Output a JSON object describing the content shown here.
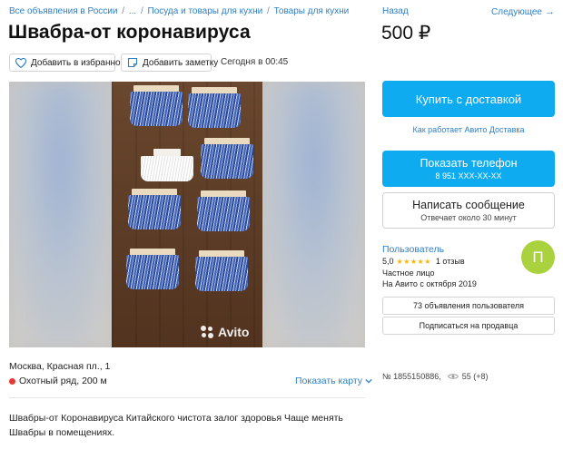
{
  "breadcrumb": {
    "items": [
      "Все объявления в России",
      "...",
      "Посуда и товары для кухни",
      "Товары для кухни"
    ],
    "separator": "/"
  },
  "listing": {
    "title": "Швабра-от коронавируса",
    "price": "500 ₽",
    "favorite_label": "Добавить в избранное",
    "note_label": "Добавить заметку",
    "posted": "Сегодня в 00:45",
    "watermark": "Avito",
    "address": "Москва, Красная пл., 1",
    "metro": "Охотный ряд, 200 м",
    "show_map": "Показать карту",
    "description": "Швабры-от Коронавируса Китайского чистота залог здоровья Чаще менять Швабры в помещениях.",
    "number": "№ 1855150886,",
    "views": "55 (+8)"
  },
  "nav": {
    "back": "Назад",
    "next": "Следующее"
  },
  "sidebar": {
    "buy_label": "Купить с доставкой",
    "delivery_link": "Как работает Авито Доставка",
    "phone_label": "Показать телефон",
    "phone_number": "8 951 XXX-XX-XX",
    "message_label": "Написать сообщение",
    "message_sub": "Отвечает около 30 минут"
  },
  "seller": {
    "name": "Пользователь",
    "rating": "5,0",
    "stars": "★★★★★",
    "reviews": "1 отзыв",
    "type": "Частное лицо",
    "since": "На Авито с октября 2019",
    "avatar_letter": "П",
    "ads_button": "73 объявления пользователя",
    "subscribe_button": "Подписаться на продавца"
  },
  "colors": {
    "accent": "#0eabf1",
    "link": "#2f80c8",
    "avatar": "#a9d23e",
    "metro": "#e53935",
    "stars": "#f5b400"
  }
}
